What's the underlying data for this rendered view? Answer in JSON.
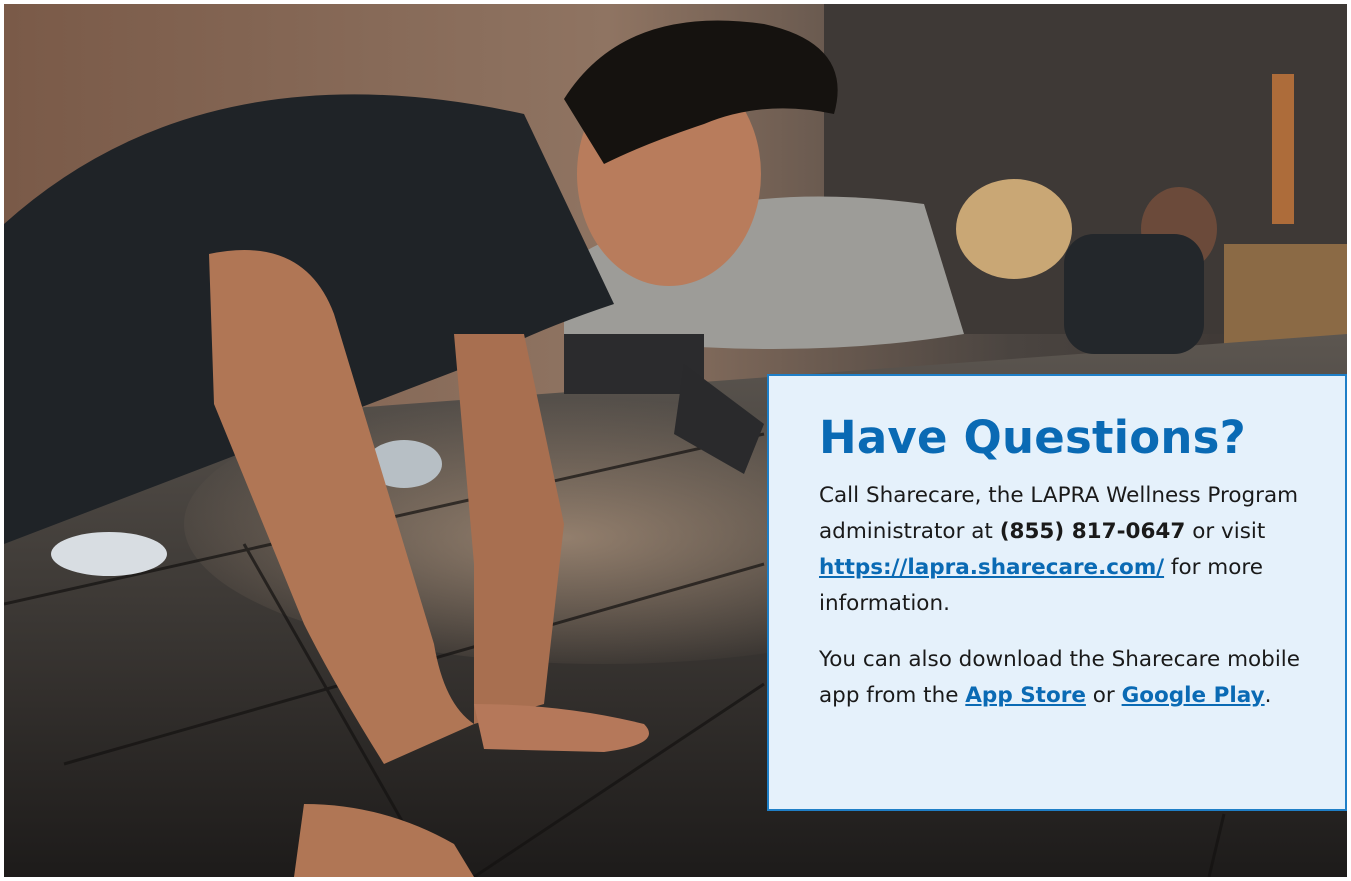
{
  "hero": {
    "image_description": "People doing push-ups on a gym floor"
  },
  "card": {
    "title": "Have Questions?",
    "p1_prefix": "Call Sharecare, the LAPRA Wellness Program administrator at ",
    "phone": "(855) 817-0647",
    "p1_mid": " or visit ",
    "website_link": "https://lapra.sharecare.com/",
    "p1_suffix": " for more information.",
    "p2_prefix": "You can also download the Sharecare mobile app from the ",
    "app_store_link": "App Store",
    "p2_mid": " or ",
    "google_play_link": "Google Play",
    "p2_suffix": "."
  },
  "colors": {
    "accent": "#0a6ab4",
    "card_background": "#e5f1fb",
    "card_border": "#1f7fc7"
  }
}
